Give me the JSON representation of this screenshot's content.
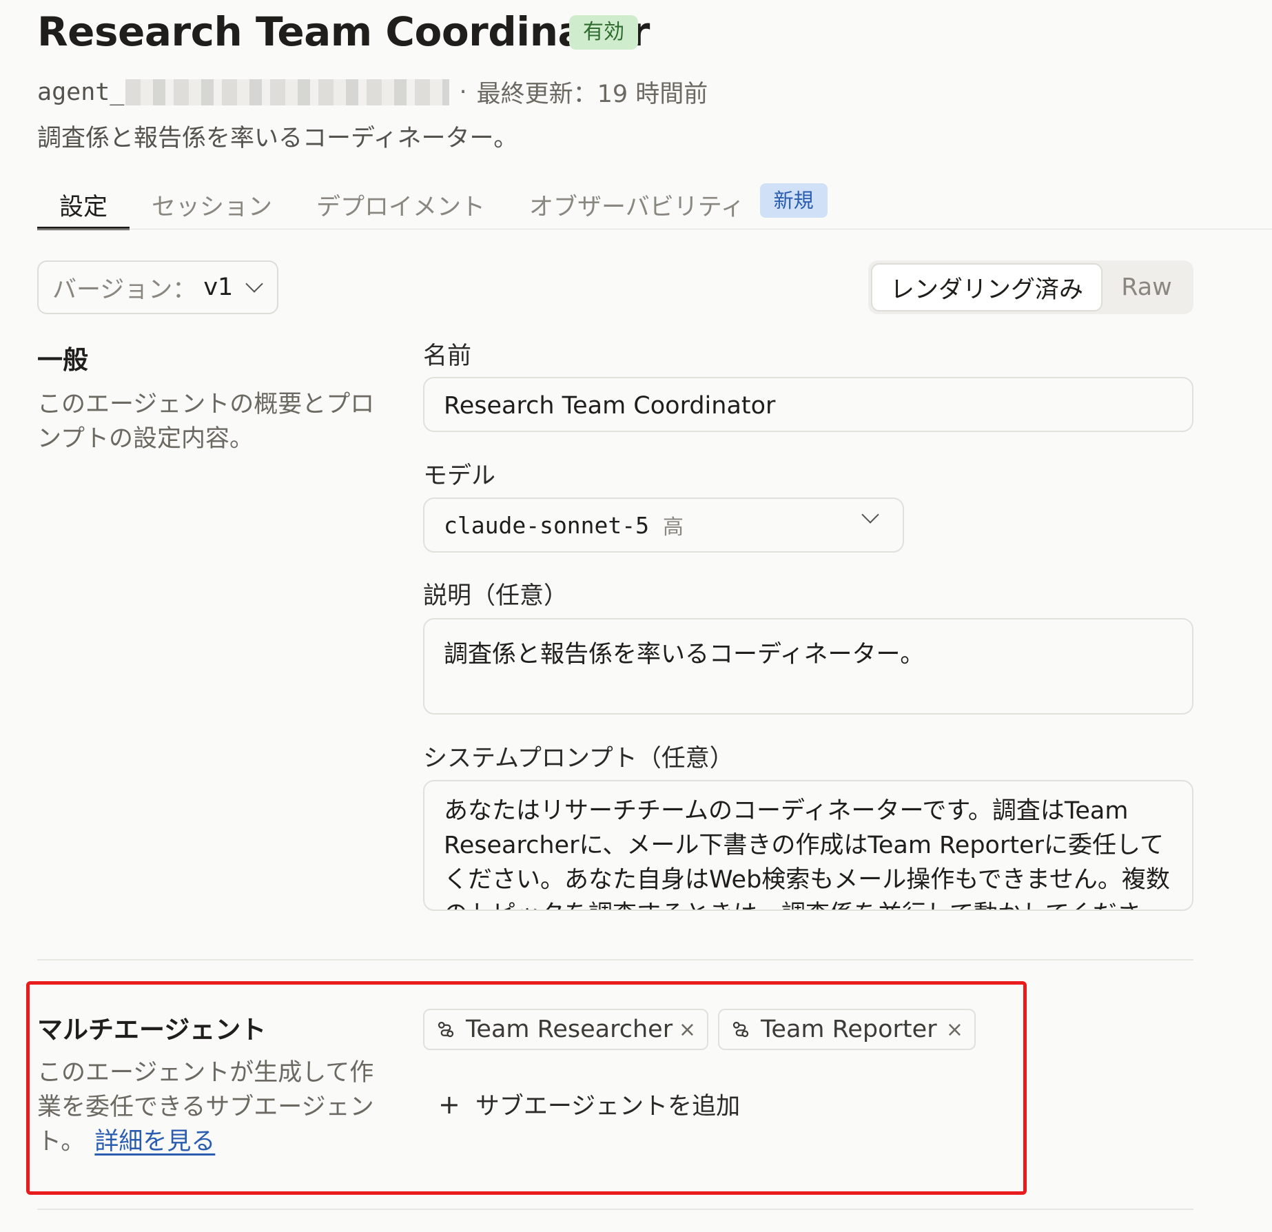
{
  "header": {
    "title": "Research Team Coordinator",
    "status": "有効",
    "agent_prefix": "agent_",
    "meta_separator": "·",
    "last_updated": "最終更新：19 時間前",
    "subtitle": "調査係と報告係を率いるコーディネーター。"
  },
  "tabs": [
    {
      "label": "設定",
      "active": true
    },
    {
      "label": "セッション"
    },
    {
      "label": "デプロイメント"
    },
    {
      "label": "オブザーバビリティ",
      "badge": "新規"
    }
  ],
  "version": {
    "label": "バージョン：",
    "value": "v1"
  },
  "render_toggle": {
    "rendered": "レンダリング済み",
    "raw": "Raw",
    "selected": "rendered"
  },
  "general": {
    "title": "一般",
    "description": "このエージェントの概要とプロンプトの設定内容。"
  },
  "fields": {
    "name_label": "名前",
    "name_value": "Research Team Coordinator",
    "model_label": "モデル",
    "model_value": "claude-sonnet-5",
    "model_effort": "高",
    "description_label": "説明（任意）",
    "description_value": "調査係と報告係を率いるコーディネーター。",
    "system_prompt_label": "システムプロンプト（任意）",
    "system_prompt_value": "あなたはリサーチチームのコーディネーターです。調査はTeam Researcherに、メール下書きの作成はTeam Reporterに委任してください。あなた自身はWeb検索もメール操作もできません。複数のトピックを調査するときは、調査係を並行して動かしてください。"
  },
  "multi_agent": {
    "title": "マルチエージェント",
    "description": "このエージェントが生成して作業を委任できるサブエージェント。",
    "learn_more": "詳細を見る",
    "subagents": [
      {
        "name": "Team Researcher",
        "remove": "×"
      },
      {
        "name": "Team Reporter",
        "remove": "×"
      }
    ],
    "add_label": "サブエージェントを追加",
    "add_icon": "+"
  },
  "colors": {
    "status_badge_bg": "#cfeccd",
    "new_badge_bg": "#cfe0f7",
    "link": "#2a5db0",
    "highlight": "#e81c1c"
  },
  "icons": {
    "subagent": "agent-link-icon",
    "remove": "close-icon",
    "dropdown": "chevron-down-icon",
    "add": "plus-icon"
  }
}
